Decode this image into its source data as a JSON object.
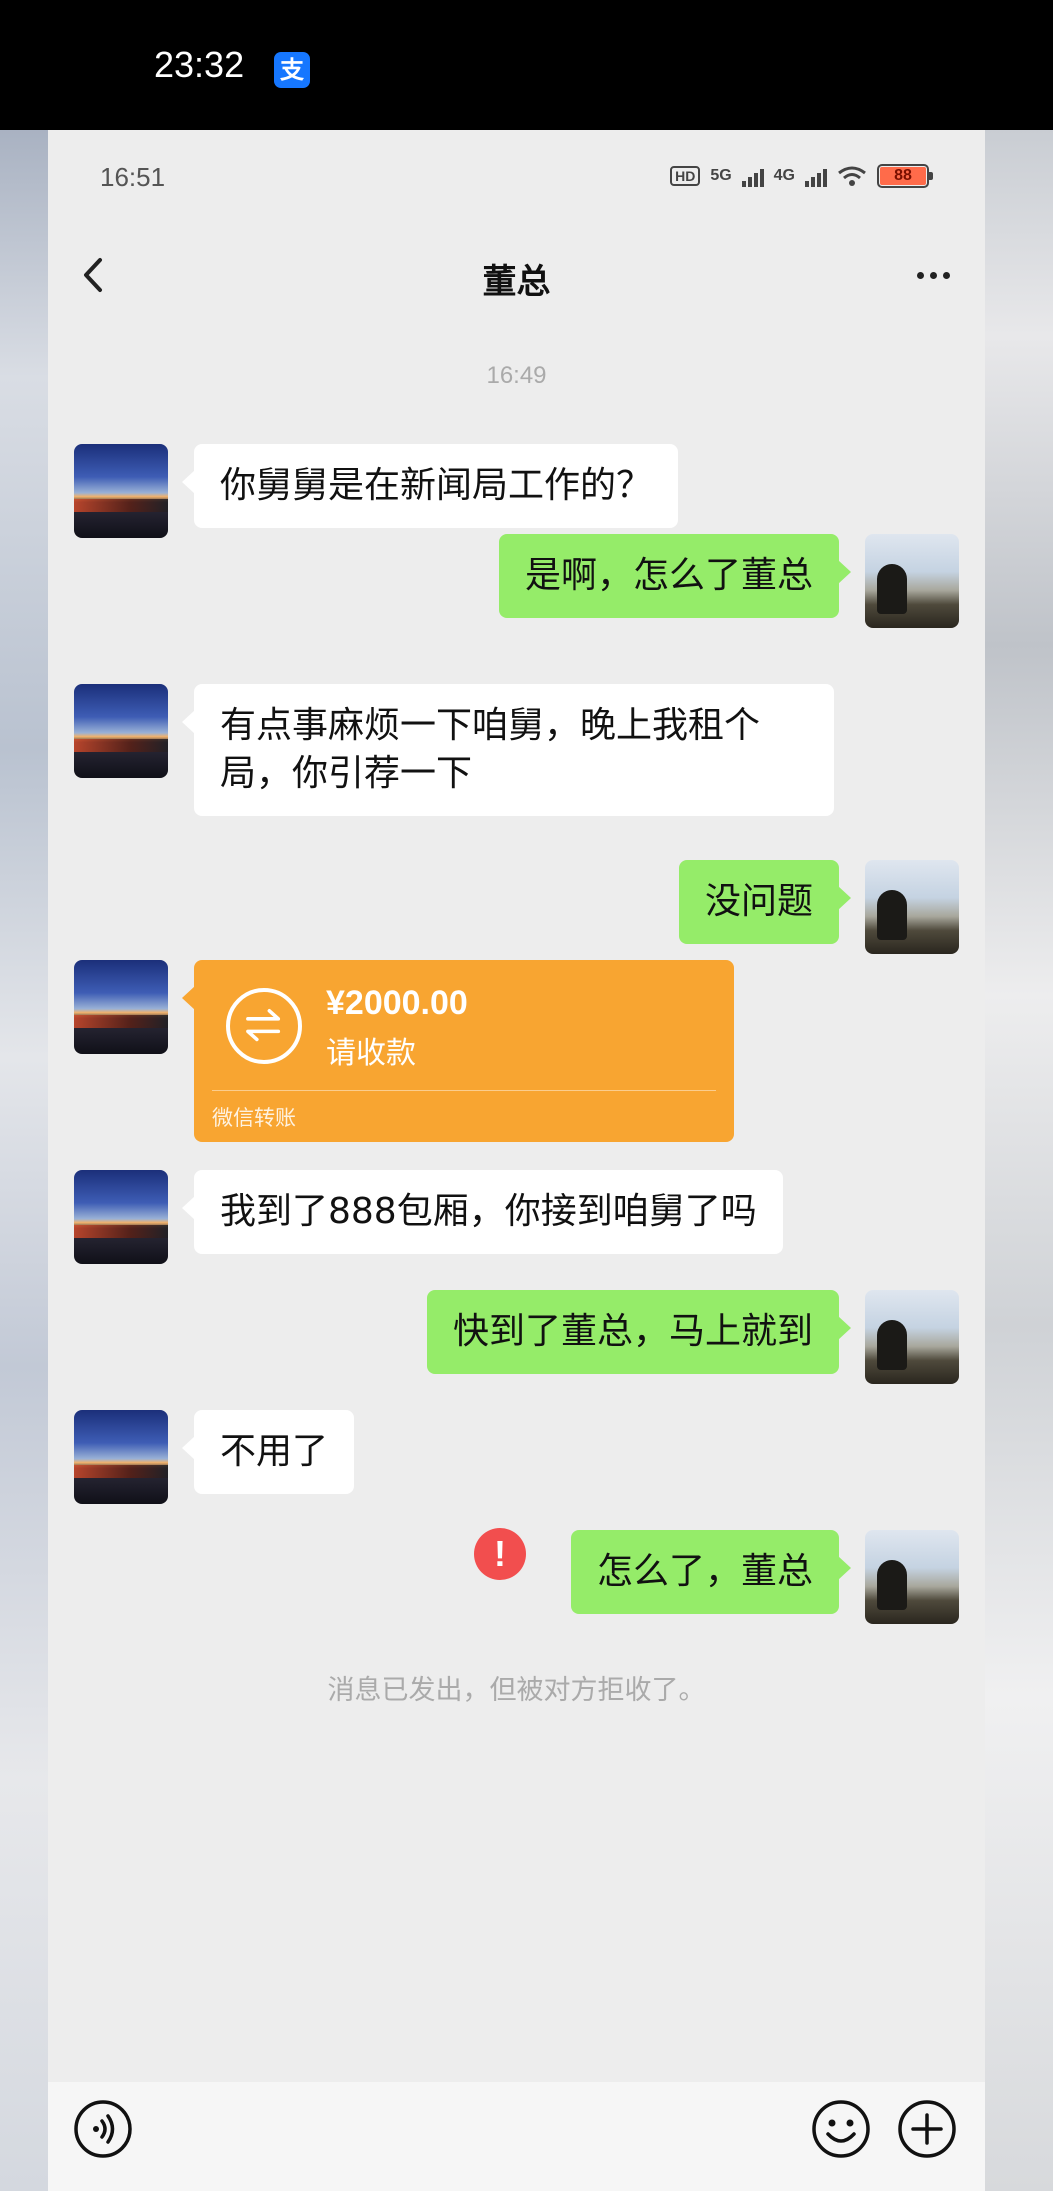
{
  "outer_status": {
    "time": "23:32",
    "app_icon_glyph": "支"
  },
  "status_bar": {
    "time": "16:51",
    "hd_label": "HD",
    "net1": "5G",
    "net2": "4G",
    "battery": "88"
  },
  "header": {
    "title": "董总"
  },
  "timestamp": "16:49",
  "messages": [
    {
      "side": "left",
      "text": "你舅舅是在新闻局工作的？"
    },
    {
      "side": "right",
      "text": "是啊，怎么了董总"
    },
    {
      "side": "left",
      "line1": "有点事麻烦一下咱舅，晚上我租个",
      "line2": "局，你引荐一下"
    },
    {
      "side": "right",
      "text": "没问题"
    },
    {
      "side": "left",
      "type": "transfer",
      "amount": "¥2000.00",
      "status": "请收款",
      "source": "微信转账"
    },
    {
      "side": "left",
      "text": "我到了888包厢，你接到咱舅了吗"
    },
    {
      "side": "right",
      "text": "快到了董总，马上就到"
    },
    {
      "side": "left",
      "text": "不用了"
    },
    {
      "side": "right",
      "text": "怎么了，董总",
      "failed": true,
      "error_glyph": "!"
    }
  ],
  "system_note": "消息已发出，但被对方拒收了。",
  "colors": {
    "bubble_me": "#95ec69",
    "bubble_other": "#ffffff",
    "transfer": "#f8a531",
    "error": "#f24e4e",
    "background": "#ededed"
  },
  "icons": [
    "back-arrow-icon",
    "more-dots-icon",
    "voice-icon",
    "emoji-icon",
    "plus-icon",
    "transfer-icon",
    "error-icon"
  ]
}
